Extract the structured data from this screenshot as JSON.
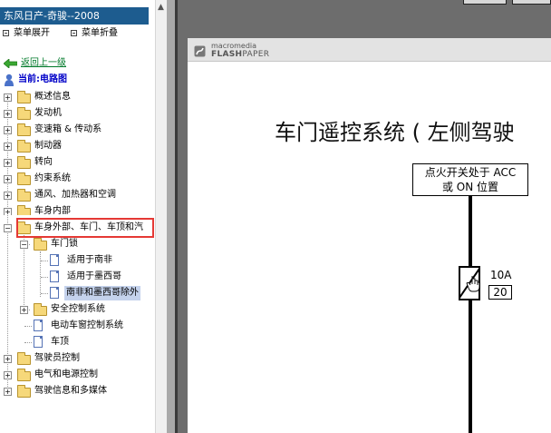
{
  "app": {
    "title": "东风日产-奇骏--2008"
  },
  "controls": {
    "expand_all": "菜单展开",
    "collapse_all": "菜单折叠"
  },
  "nav": {
    "back_label": "返回上一级",
    "current_label": "当前:电路图"
  },
  "tree": {
    "items": [
      "概述信息",
      "发动机",
      "变速箱 & 传动系",
      "制动器",
      "转向",
      "约束系统",
      "通风、加热器和空调",
      "车身内部",
      "车身外部、车门、车顶和汽",
      "车门锁",
      "适用于南非",
      "适用于墨西哥",
      "南非和墨西哥除外",
      "安全控制系统",
      "电动车窗控制系统",
      "车顶",
      "驾驶员控制",
      "电气和电源控制",
      "驾驶信息和多媒体"
    ]
  },
  "viewer": {
    "brand_top": "macromedia",
    "brand_bottom_bold": "FLASH",
    "brand_bottom_light": "PAPER",
    "doc_title": "车门遥控系统 ( 左侧驾驶",
    "switch_line1": "点火开关处于 ACC",
    "switch_line2": "或 ON 位置",
    "fuse_amp": "10A",
    "fuse_num": "20"
  },
  "colors": {
    "title_bar": "#1d5c8f",
    "highlight": "#e53935",
    "back_link": "#007a2a",
    "current": "#0000c8"
  },
  "icons": [
    "back-arrow-icon",
    "user-icon",
    "folder-icon",
    "document-icon",
    "flashpaper-logo-icon",
    "fuse-icon"
  ]
}
